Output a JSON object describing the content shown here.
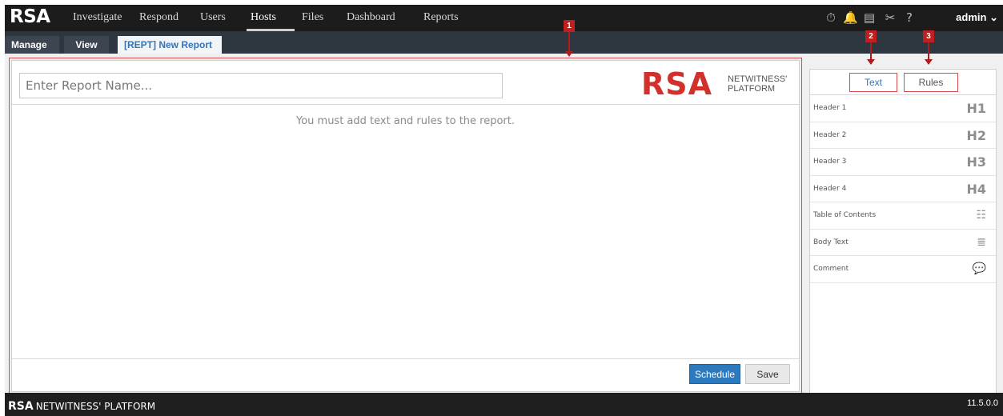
{
  "nav": {
    "logo": "RSA",
    "items": [
      "Investigate",
      "Respond",
      "Users",
      "Hosts",
      "Files",
      "Dashboard",
      "Reports"
    ],
    "active": "Hosts",
    "user": "admin"
  },
  "tabs": {
    "manage": "Manage",
    "view": "View",
    "active_tab": "[REPT] New Report"
  },
  "report": {
    "name_placeholder": "Enter Report Name...",
    "brand_big": "RSA",
    "brand_line1": "NETWITNESS'",
    "brand_line2": "PLATFORM",
    "empty_message": "You must add text and rules to the report.",
    "schedule_label": "Schedule",
    "save_label": "Save"
  },
  "side": {
    "tab_text": "Text",
    "tab_rules": "Rules",
    "items": [
      {
        "label": "Header 1",
        "icon": "H1"
      },
      {
        "label": "Header 2",
        "icon": "H2"
      },
      {
        "label": "Header 3",
        "icon": "H3"
      },
      {
        "label": "Header 4",
        "icon": "H4"
      },
      {
        "label": "Table of Contents",
        "icon": "☷"
      },
      {
        "label": "Body Text",
        "icon": "≣"
      },
      {
        "label": "Comment",
        "icon": "💬"
      }
    ]
  },
  "footer": {
    "brand": "RSA",
    "product": "NETWITNESS' PLATFORM",
    "version": "11.5.0.0"
  },
  "callouts": [
    "1",
    "2",
    "3"
  ],
  "colors": {
    "accent": "#2c79bf",
    "callout": "#c01f1f",
    "brand_red": "#d1302c"
  }
}
